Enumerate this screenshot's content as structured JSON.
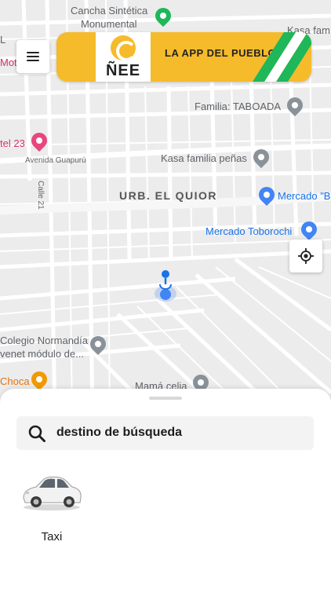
{
  "map": {
    "labels": {
      "cancha": "Cancha Sintética",
      "monumental": "Monumental",
      "kasa_fam": "Kasa fam",
      "motel_left": "Mote",
      "letter_l": "L",
      "familia_taboada": "Familia: TABOADA",
      "motel23": "tel 23",
      "avenida": "Avenida Guapurú",
      "kasa_familia": "Kasa familia peñas",
      "calle21": "Calle 21",
      "urb": "URB. EL QUIOR",
      "mercado_b": "Mercado \"B",
      "mercado_toborochi": "Mercado Toborochi",
      "colegio": "Colegio Normandía",
      "venet": "venet módulo de...",
      "choca": "Choca",
      "mama_celia": "Mamá celia"
    }
  },
  "header": {
    "menu_icon": "hamburger-menu-icon",
    "banner": {
      "logo_text": "ÑEE",
      "slogan": "LA APP DEL PUEBLO",
      "colors": {
        "background": "#f6bb2a",
        "stripe_green": "#1eb75a",
        "stripe_white": "#ffffff"
      }
    }
  },
  "controls": {
    "locate_icon": "my-location-icon"
  },
  "sheet": {
    "search_icon": "search-icon",
    "search_text": "destino de búsqueda",
    "vehicles": [
      {
        "label": "Taxi",
        "icon": "car-icon"
      }
    ]
  }
}
